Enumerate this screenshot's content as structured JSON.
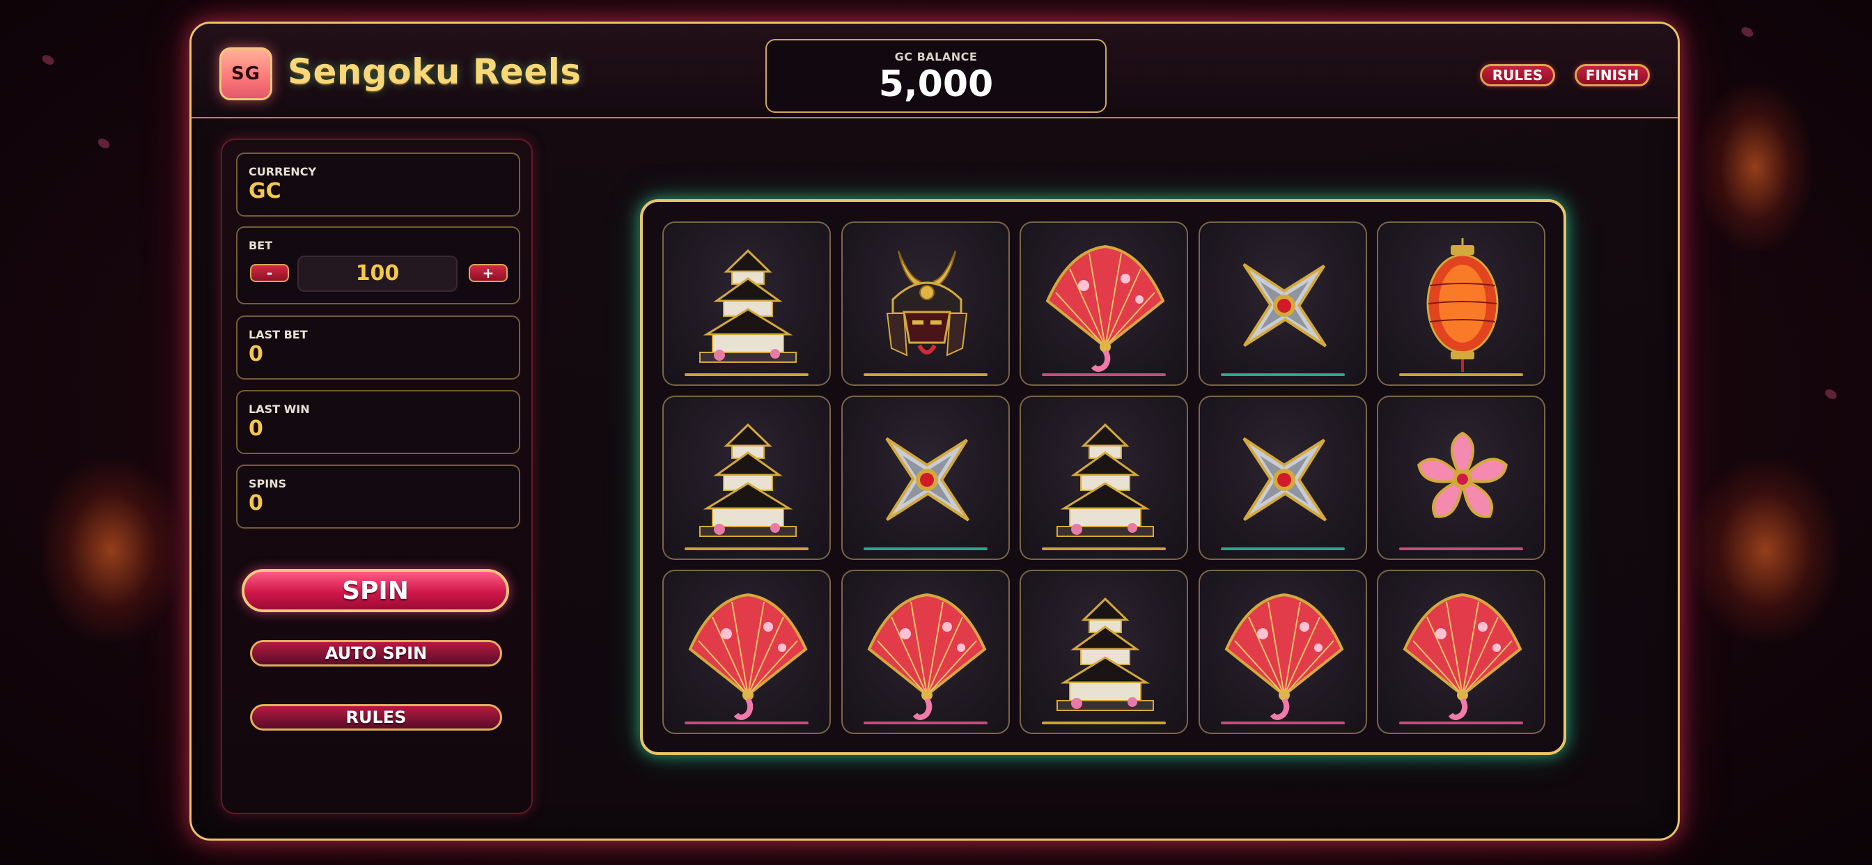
{
  "app": {
    "badge": "SG",
    "title": "Sengoku Reels"
  },
  "balance": {
    "label": "GC BALANCE",
    "value": "5,000"
  },
  "header_buttons": {
    "rules": "RULES",
    "finish": "FINISH"
  },
  "panel": {
    "currency": {
      "label": "CURRENCY",
      "value": "GC"
    },
    "bet": {
      "label": "BET",
      "minus": "-",
      "plus": "+",
      "value": "100"
    },
    "last_bet": {
      "label": "LAST BET",
      "value": "0"
    },
    "last_win": {
      "label": "LAST WIN",
      "value": "0"
    },
    "spins": {
      "label": "SPINS",
      "value": "0"
    },
    "spin_button": "SPIN",
    "auto_spin_button": "AUTO SPIN",
    "rules_button": "RULES"
  },
  "reels": {
    "grid": [
      [
        "castle",
        "samurai-helmet",
        "fan",
        "shuriken",
        "lantern"
      ],
      [
        "castle",
        "shuriken",
        "castle",
        "shuriken",
        "sakura"
      ],
      [
        "fan",
        "fan",
        "castle",
        "fan",
        "fan"
      ]
    ],
    "symbol_colors": {
      "castle": "#c9a43a",
      "samurai-helmet": "#c9a43a",
      "fan": "#c0507a",
      "shuriken": "#2aa88a",
      "lantern": "#c9a43a",
      "sakura": "#c0507a"
    }
  },
  "colors": {
    "gold": "#e8c46a",
    "accent_red": "#c8213d",
    "reel_glow": "#3cffb4",
    "value_yellow": "#f5c84a"
  }
}
